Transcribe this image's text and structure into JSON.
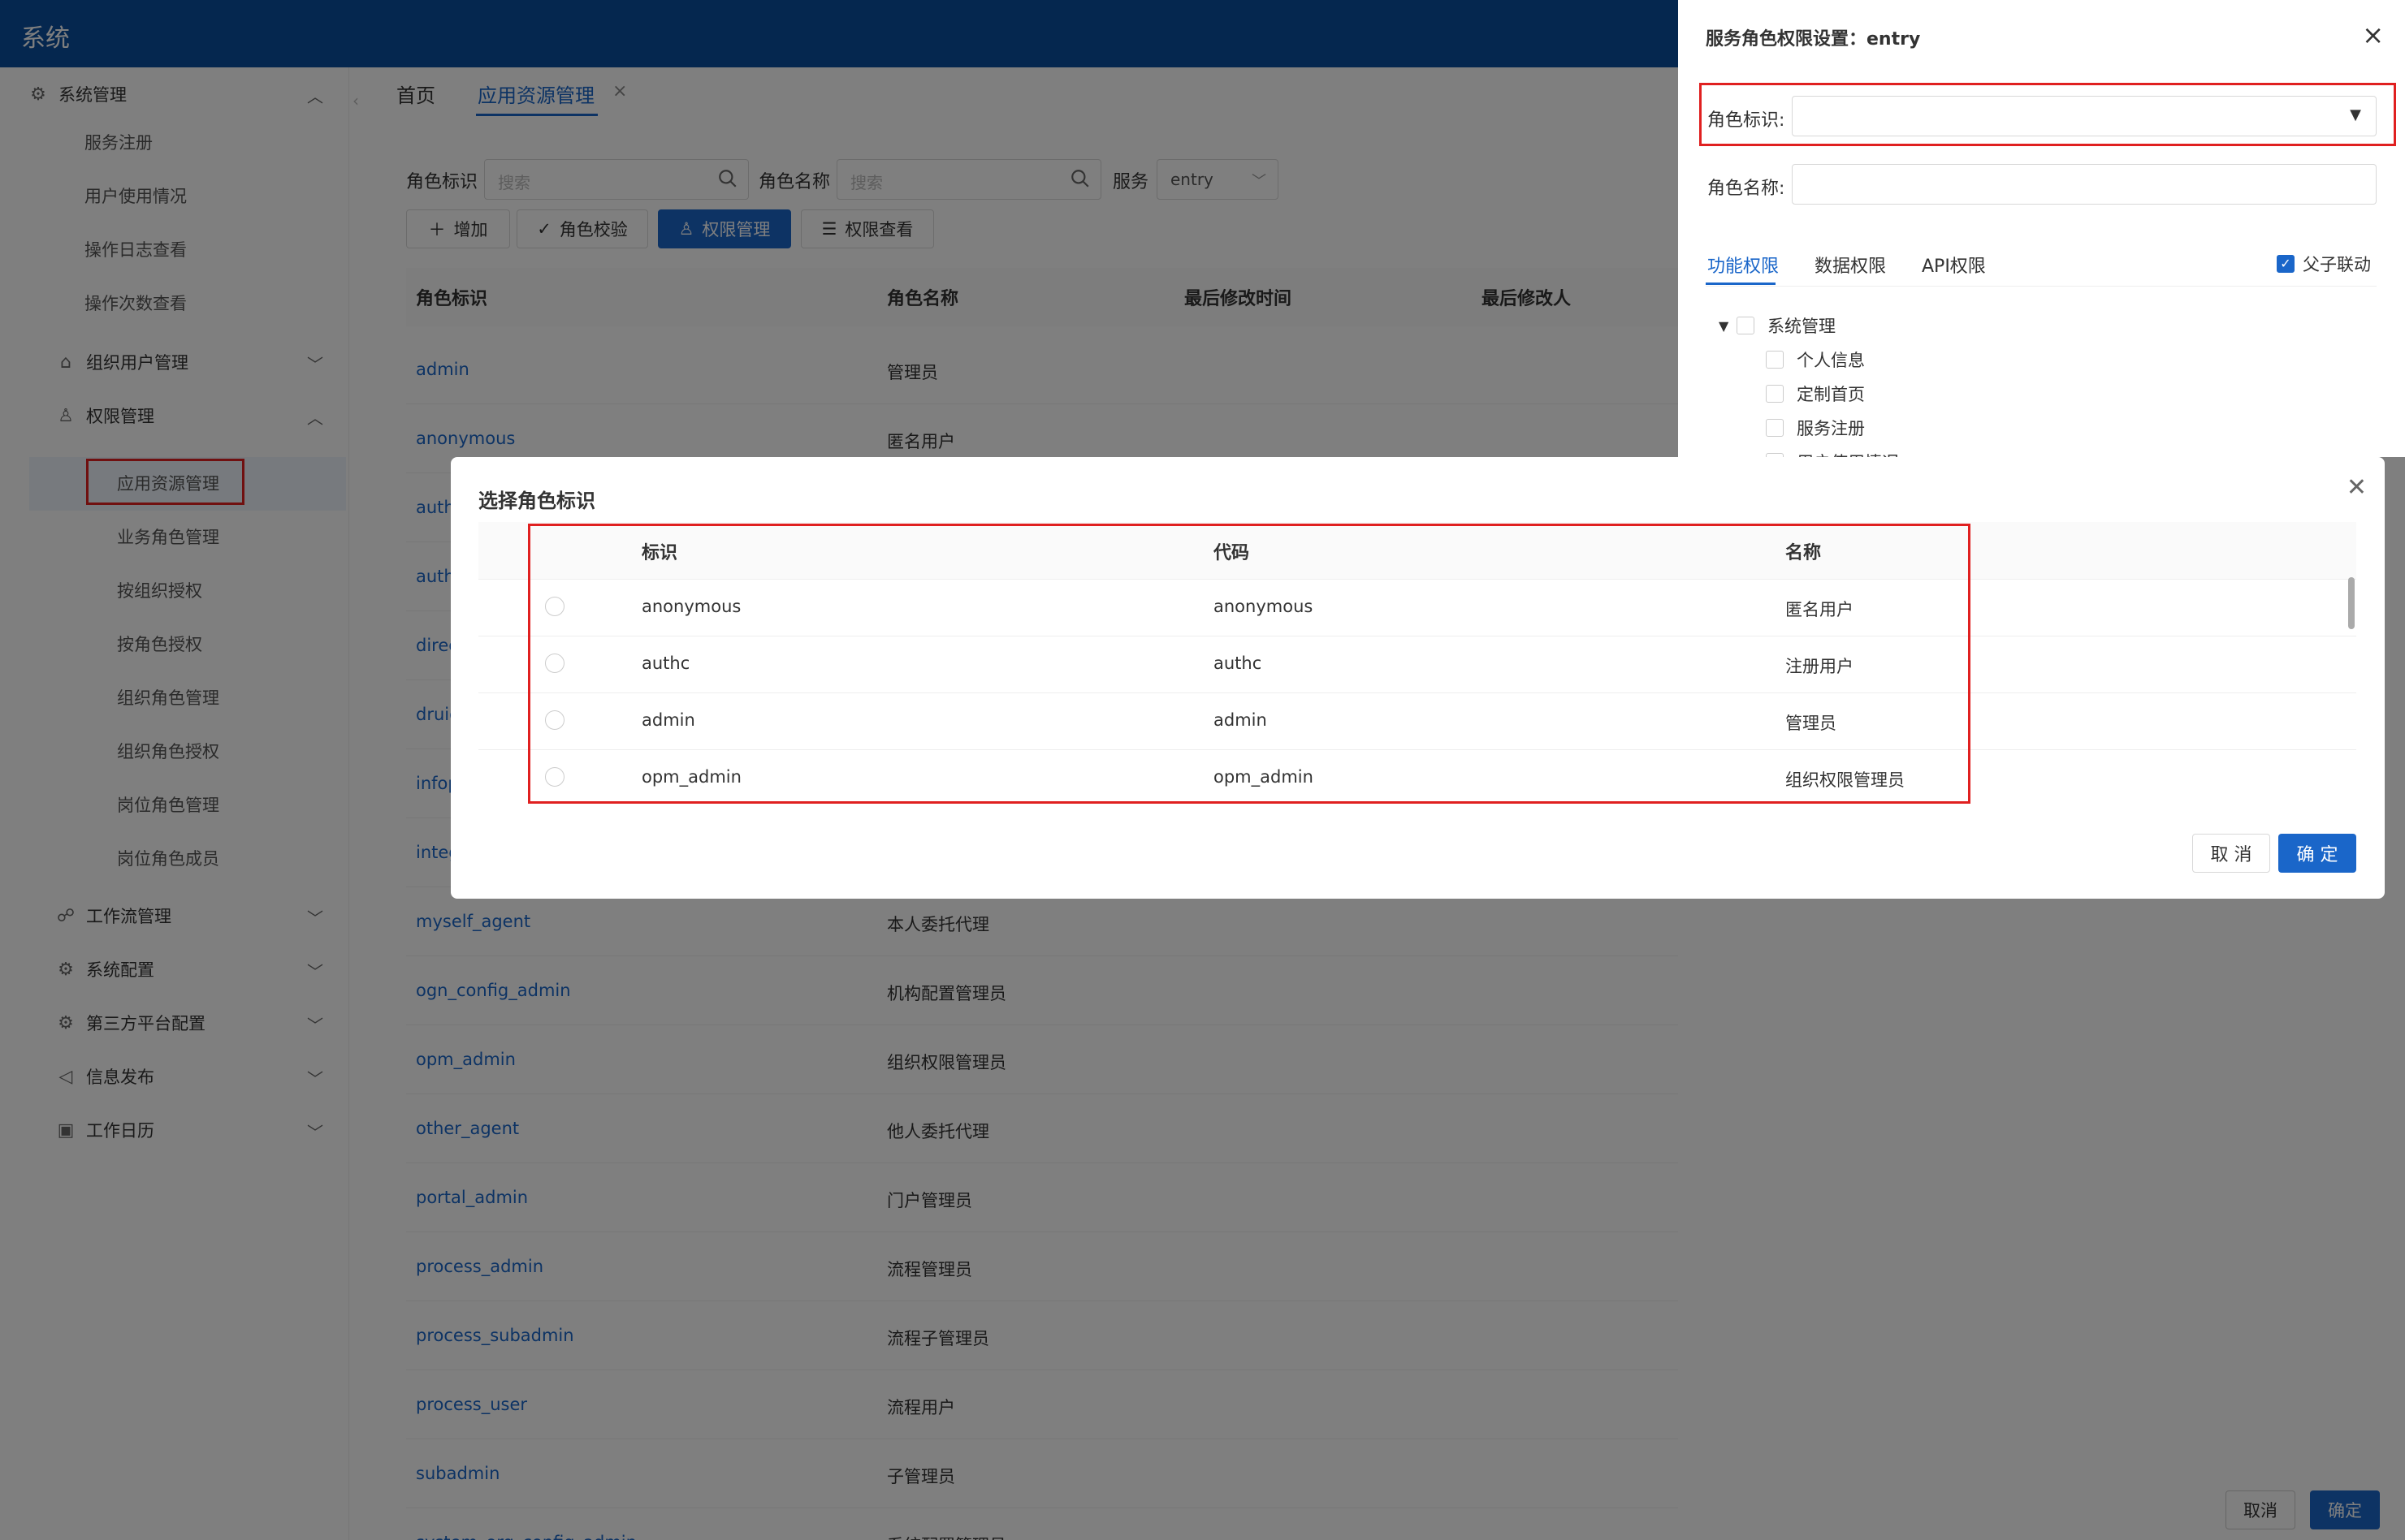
{
  "app": {
    "title": "系统"
  },
  "sidebar": {
    "groups": [
      {
        "label": "系统管理",
        "icon": "gear-icon"
      },
      {
        "label": "组织用户管理",
        "icon": "bank-icon"
      },
      {
        "label": "权限管理",
        "icon": "user-lock-icon"
      },
      {
        "label": "工作流管理",
        "icon": "workflow-icon"
      },
      {
        "label": "系统配置",
        "icon": "gear-icon"
      },
      {
        "label": "第三方平台配置",
        "icon": "gear-icon"
      },
      {
        "label": "信息发布",
        "icon": "speaker-icon"
      },
      {
        "label": "工作日历",
        "icon": "calendar-icon"
      }
    ],
    "sys_items": [
      "服务注册",
      "用户使用情况",
      "操作日志查看",
      "操作次数查看"
    ],
    "perm_items": [
      "应用资源管理",
      "业务角色管理",
      "按组织授权",
      "按角色授权",
      "组织角色管理",
      "组织角色授权",
      "岗位角色管理",
      "岗位角色成员"
    ]
  },
  "tabs": {
    "home": "首页",
    "active": "应用资源管理"
  },
  "filters": {
    "role_id_label": "角色标识",
    "role_id_placeholder": "搜索",
    "role_name_label": "角色名称",
    "role_name_placeholder": "搜索",
    "service_label": "服务",
    "service_value": "entry"
  },
  "toolbar": {
    "add": "增加",
    "verify": "角色校验",
    "perm_manage": "权限管理",
    "perm_view": "权限查看"
  },
  "table": {
    "headers": [
      "角色标识",
      "角色名称",
      "最后修改时间",
      "最后修改人"
    ],
    "rows": [
      {
        "id": "admin",
        "name": "管理员"
      },
      {
        "id": "anonymous",
        "name": "匿名用户"
      },
      {
        "id": "auth",
        "name": ""
      },
      {
        "id": "auth",
        "name": ""
      },
      {
        "id": "direc",
        "name": ""
      },
      {
        "id": "druid",
        "name": ""
      },
      {
        "id": "infop",
        "name": ""
      },
      {
        "id": "integ",
        "name": ""
      },
      {
        "id": "myself_agent",
        "name": "本人委托代理"
      },
      {
        "id": "ogn_config_admin",
        "name": "机构配置管理员"
      },
      {
        "id": "opm_admin",
        "name": "组织权限管理员"
      },
      {
        "id": "other_agent",
        "name": "他人委托代理"
      },
      {
        "id": "portal_admin",
        "name": "门户管理员"
      },
      {
        "id": "process_admin",
        "name": "流程管理员"
      },
      {
        "id": "process_subadmin",
        "name": "流程子管理员"
      },
      {
        "id": "process_user",
        "name": "流程用户"
      },
      {
        "id": "subadmin",
        "name": "子管理员"
      },
      {
        "id": "system_org_config_admin",
        "name": "系统配置管理员"
      }
    ]
  },
  "drawer": {
    "title": "服务角色权限设置：entry",
    "role_id_label": "角色标识:",
    "role_name_label": "角色名称:",
    "tabs": [
      "功能权限",
      "数据权限",
      "API权限"
    ],
    "link_label": "父子联动",
    "tree": {
      "root": "系统管理",
      "children": [
        "个人信息",
        "定制首页",
        "服务注册",
        "用户使用情况"
      ]
    },
    "cancel": "取消",
    "confirm": "确定"
  },
  "modal": {
    "title": "选择角色标识",
    "headers": [
      "标识",
      "代码",
      "名称"
    ],
    "rows": [
      {
        "id": "anonymous",
        "code": "anonymous",
        "name": "匿名用户"
      },
      {
        "id": "authc",
        "code": "authc",
        "name": "注册用户"
      },
      {
        "id": "admin",
        "code": "admin",
        "name": "管理员"
      },
      {
        "id": "opm_admin",
        "code": "opm_admin",
        "name": "组织权限管理员"
      }
    ],
    "cancel": "取 消",
    "confirm": "确 定"
  },
  "colors": {
    "primary": "#1a66c9",
    "header": "#0a4e9e",
    "highlight": "#e02020"
  }
}
